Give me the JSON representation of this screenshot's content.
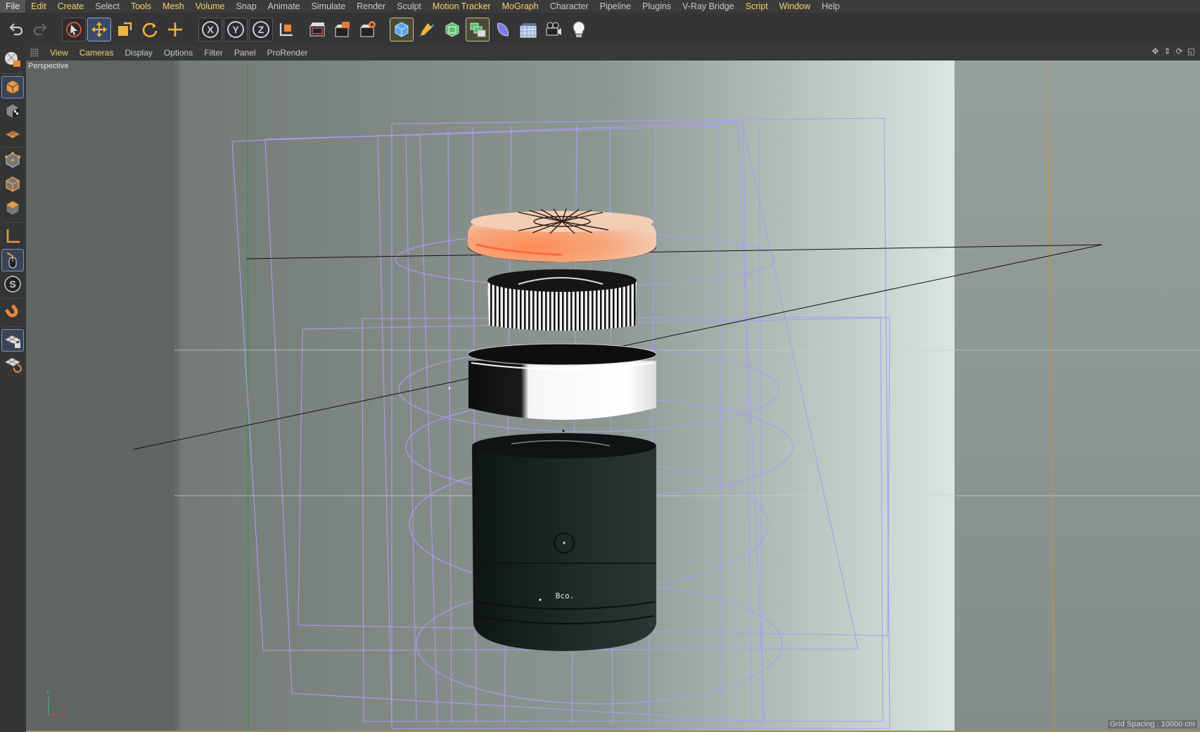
{
  "menu": {
    "items": [
      {
        "label": "File",
        "state": "active"
      },
      {
        "label": "Edit",
        "state": "highlight"
      },
      {
        "label": "Create",
        "state": "highlight"
      },
      {
        "label": "Select",
        "state": "normal"
      },
      {
        "label": "Tools",
        "state": "highlight"
      },
      {
        "label": "Mesh",
        "state": "highlight"
      },
      {
        "label": "Volume",
        "state": "highlight"
      },
      {
        "label": "Snap",
        "state": "normal"
      },
      {
        "label": "Animate",
        "state": "normal"
      },
      {
        "label": "Simulate",
        "state": "normal"
      },
      {
        "label": "Render",
        "state": "normal"
      },
      {
        "label": "Sculpt",
        "state": "normal"
      },
      {
        "label": "Motion Tracker",
        "state": "highlight"
      },
      {
        "label": "MoGraph",
        "state": "highlight"
      },
      {
        "label": "Character",
        "state": "normal"
      },
      {
        "label": "Pipeline",
        "state": "normal"
      },
      {
        "label": "Plugins",
        "state": "normal"
      },
      {
        "label": "V-Ray Bridge",
        "state": "normal"
      },
      {
        "label": "Script",
        "state": "highlight"
      },
      {
        "label": "Window",
        "state": "highlight"
      },
      {
        "label": "Help",
        "state": "normal"
      }
    ]
  },
  "toolbar": {
    "undo": "undo-icon",
    "redo": "redo-icon",
    "live_select": "live-selection-icon",
    "move": "move-icon",
    "scale": "scale-icon",
    "rotate": "rotate-icon",
    "recent": "recent-tool-icon",
    "x_axis": "X",
    "y_axis": "Y",
    "z_axis": "Z",
    "coord_system": "coordinate-system-icon",
    "render_view": "render-view-icon",
    "render_picture_viewer": "render-picture-viewer-icon",
    "render_settings": "render-settings-icon",
    "cube": "cube-icon",
    "pen": "pen-icon",
    "subdivision": "subdivision-surface-icon",
    "cloner": "cloner-icon",
    "deformer": "deformer-icon",
    "floor": "floor-icon",
    "camera": "camera-icon",
    "light": "light-icon"
  },
  "leftbar": {
    "icons": [
      "make-editable-icon",
      "model-mode-icon",
      "texture-mode-icon",
      "workplane-icon",
      "points-mode-icon",
      "edges-mode-icon",
      "polygons-mode-icon",
      "axis-icon",
      "tweak-mode-icon",
      "solo-icon",
      "snap-magnet-icon",
      "locked-workplane-icon",
      "planar-workplane-icon"
    ]
  },
  "viewport_menu": {
    "items": [
      {
        "label": "View",
        "state": "highlight"
      },
      {
        "label": "Cameras",
        "state": "highlight"
      },
      {
        "label": "Display",
        "state": "normal"
      },
      {
        "label": "Options",
        "state": "normal"
      },
      {
        "label": "Filter",
        "state": "normal"
      },
      {
        "label": "Panel",
        "state": "normal"
      },
      {
        "label": "ProRender",
        "state": "normal"
      }
    ],
    "nav_icons": [
      "move-view-icon",
      "zoom-view-icon",
      "rotate-view-icon",
      "toggle-view-icon"
    ]
  },
  "viewport": {
    "camera_label": "Perspective",
    "grid_spacing": "Grid Spacing : 10000 cm",
    "axis_y": "Y",
    "axis_x": "X",
    "model_text": "Bco."
  },
  "colors": {
    "menu_highlight": "#f3d36b",
    "wireframe": "#a99cf2",
    "lid_orange": "#f39c6b",
    "body_dark": "#1d2a28",
    "accent_frame": "#8aa6d6"
  }
}
